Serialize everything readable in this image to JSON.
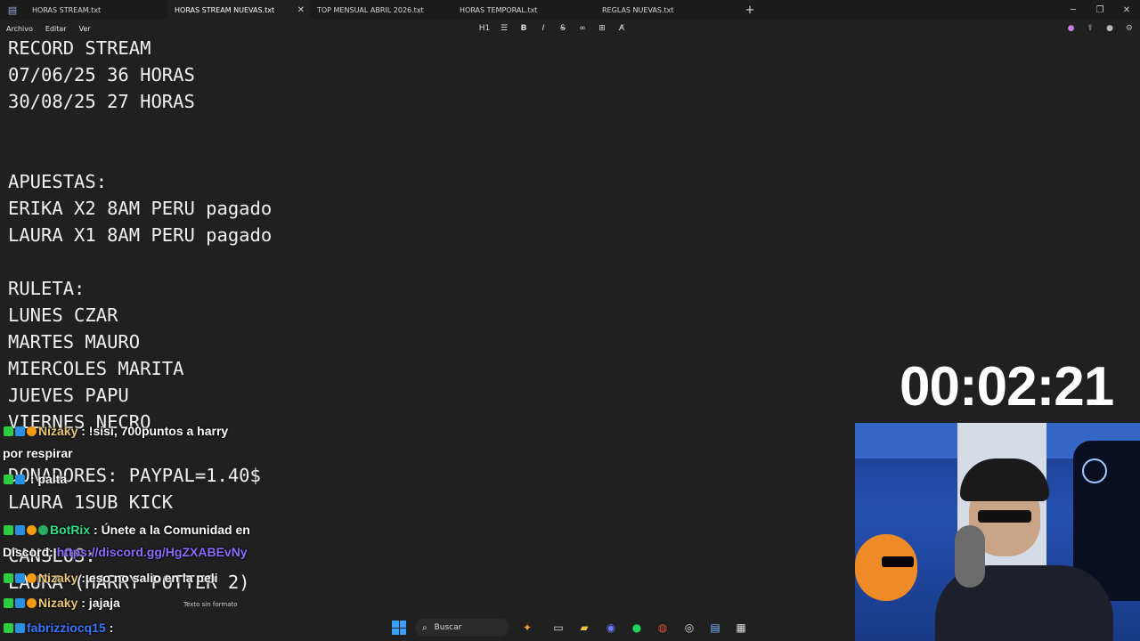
{
  "tabs": [
    {
      "label": "HORAS STREAM.txt",
      "active": false
    },
    {
      "label": "HORAS STREAM NUEVAS.txt",
      "active": true
    },
    {
      "label": "TOP MENSUAL ABRIL 2026.txt",
      "active": false
    },
    {
      "label": "HORAS TEMPORAL.txt",
      "active": false
    },
    {
      "label": "REGLAS NUEVAS.txt",
      "active": false
    }
  ],
  "menu": {
    "file": "Archivo",
    "edit": "Editar",
    "view": "Ver",
    "heading": "H1"
  },
  "editor_lines": [
    "RECORD STREAM",
    "07/06/25 36 HORAS",
    "30/08/25 27 HORAS",
    "",
    "",
    "APUESTAS:",
    "ERIKA X2 8AM PERU pagado",
    "LAURA X1 8AM PERU pagado",
    "",
    "RULETA:",
    "LUNES CZAR",
    "MARTES MAURO",
    "MIERCOLES MARITA",
    "JUEVES PAPU",
    "VIERNES NECRO",
    "",
    "DONADORES: PAYPAL=1.40$",
    "LAURA 1SUB KICK",
    "",
    "CANSLOS:",
    "LAURA (HARRY POTTER 2)"
  ],
  "timer": "00:02:21",
  "chat": [
    {
      "user": "Nizaky",
      "text": " : !sisi, 700puntos a harry",
      "cont": "por respirar"
    },
    {
      "user": "",
      "text": " : palta"
    },
    {
      "user": "BotRix",
      "text": " : Únete a la Comunidad en",
      "cont": "Discord: ",
      "link": "https://discord.gg/HgZXABEvNy"
    },
    {
      "user": "Nizaky",
      "text": " : eso no salio en la peli"
    },
    {
      "user": "Nizaky",
      "text": " : jajaja"
    },
    {
      "user": "fabrizziocq15",
      "text": " : "
    }
  ],
  "status": "Texto sin formato",
  "taskbar": {
    "search_placeholder": "Buscar"
  },
  "colors": {
    "background": "#202020",
    "chat_name": "#e8c872",
    "bot_name": "#2ee08a",
    "link": "#8a6cff"
  }
}
